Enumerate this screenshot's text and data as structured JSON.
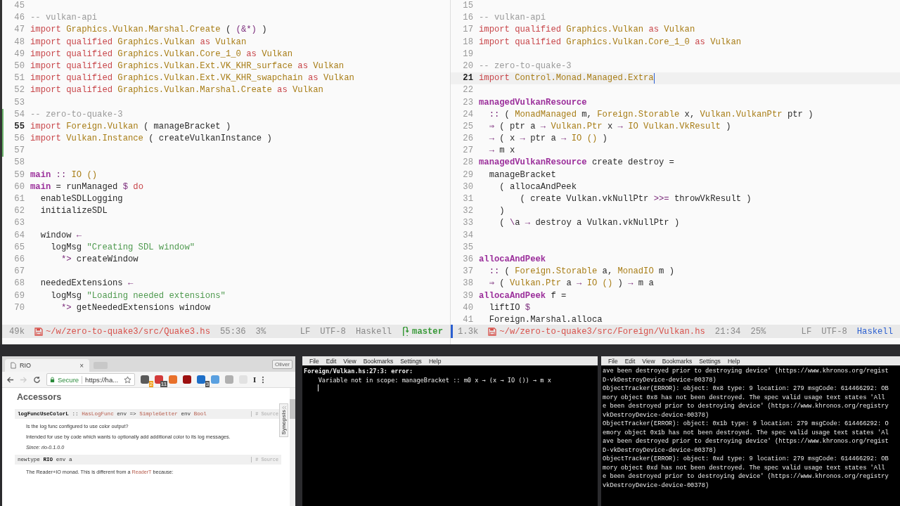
{
  "editors": [
    {
      "active": false,
      "lines": [
        {
          "n": "45",
          "current": false,
          "changed": false
        },
        {
          "n": "46",
          "current": false,
          "changed": false,
          "tokens": [
            {
              "kind": "comment",
              "text": "-- vulkan-api"
            }
          ]
        },
        {
          "n": "47",
          "current": false,
          "changed": false,
          "tokens": [
            {
              "kind": "kw",
              "text": "import"
            },
            {
              "kind": "mod",
              "text": " Graphics.Vulkan.Marshal.Create"
            },
            {
              "kind": "plain",
              "text": " ( "
            },
            {
              "kind": "op",
              "text": "(&*)"
            },
            {
              "kind": "plain",
              "text": " )"
            }
          ]
        },
        {
          "n": "48",
          "current": false,
          "changed": false,
          "tokens": [
            {
              "kind": "kw",
              "text": "import qualified"
            },
            {
              "kind": "mod",
              "text": " Graphics.Vulkan"
            },
            {
              "kind": "kw",
              "text": " as"
            },
            {
              "kind": "mod",
              "text": " Vulkan"
            }
          ]
        },
        {
          "n": "49",
          "current": false,
          "changed": false,
          "tokens": [
            {
              "kind": "kw",
              "text": "import qualified"
            },
            {
              "kind": "mod",
              "text": " Graphics.Vulkan.Core_1_0"
            },
            {
              "kind": "kw",
              "text": " as"
            },
            {
              "kind": "mod",
              "text": " Vulkan"
            }
          ]
        },
        {
          "n": "50",
          "current": false,
          "changed": false,
          "tokens": [
            {
              "kind": "kw",
              "text": "import qualified"
            },
            {
              "kind": "mod",
              "text": " Graphics.Vulkan.Ext.VK_KHR_surface"
            },
            {
              "kind": "kw",
              "text": " as"
            },
            {
              "kind": "mod",
              "text": " Vulkan"
            }
          ]
        },
        {
          "n": "51",
          "current": false,
          "changed": false,
          "tokens": [
            {
              "kind": "kw",
              "text": "import qualified"
            },
            {
              "kind": "mod",
              "text": " Graphics.Vulkan.Ext.VK_KHR_swapchain"
            },
            {
              "kind": "kw",
              "text": " as"
            },
            {
              "kind": "mod",
              "text": " Vulkan"
            }
          ]
        },
        {
          "n": "52",
          "current": false,
          "changed": false,
          "tokens": [
            {
              "kind": "kw",
              "text": "import qualified"
            },
            {
              "kind": "mod",
              "text": " Graphics.Vulkan.Marshal.Create"
            },
            {
              "kind": "kw",
              "text": " as"
            },
            {
              "kind": "mod",
              "text": " Vulkan"
            }
          ]
        },
        {
          "n": "53",
          "current": false,
          "changed": false
        },
        {
          "n": "54",
          "current": false,
          "changed": true,
          "tokens": [
            {
              "kind": "comment",
              "text": "-- zero-to-quake-3"
            }
          ]
        },
        {
          "n": "55",
          "current": true,
          "changed": true,
          "tokens": [
            {
              "kind": "kw",
              "text": "import"
            },
            {
              "kind": "mod",
              "text": " Foreign.Vulkan"
            },
            {
              "kind": "plain",
              "text": " ( manageBracket )"
            }
          ]
        },
        {
          "n": "56",
          "current": false,
          "changed": true,
          "tokens": [
            {
              "kind": "kw",
              "text": "import"
            },
            {
              "kind": "mod",
              "text": " Vulkan.Instance"
            },
            {
              "kind": "plain",
              "text": " ( createVulkanInstance )"
            }
          ]
        },
        {
          "n": "57",
          "current": false,
          "changed": true
        },
        {
          "n": "58",
          "current": false,
          "changed": false
        },
        {
          "n": "59",
          "current": false,
          "changed": false,
          "tokens": [
            {
              "kind": "def",
              "text": "main"
            },
            {
              "kind": "op",
              "text": " ::"
            },
            {
              "kind": "mod",
              "text": " IO ()"
            }
          ]
        },
        {
          "n": "60",
          "current": false,
          "changed": false,
          "tokens": [
            {
              "kind": "def",
              "text": "main"
            },
            {
              "kind": "plain",
              "text": " = runManaged "
            },
            {
              "kind": "op",
              "text": "$"
            },
            {
              "kind": "kw",
              "text": " do"
            }
          ]
        },
        {
          "n": "61",
          "current": false,
          "changed": false,
          "tokens": [
            {
              "kind": "plain",
              "text": "  enableSDLLogging"
            }
          ]
        },
        {
          "n": "62",
          "current": false,
          "changed": false,
          "tokens": [
            {
              "kind": "plain",
              "text": "  initializeSDL"
            }
          ]
        },
        {
          "n": "63",
          "current": false,
          "changed": false
        },
        {
          "n": "64",
          "current": false,
          "changed": false,
          "tokens": [
            {
              "kind": "plain",
              "text": "  window "
            },
            {
              "kind": "op",
              "text": "←"
            }
          ]
        },
        {
          "n": "65",
          "current": false,
          "changed": false,
          "tokens": [
            {
              "kind": "plain",
              "text": "    logMsg "
            },
            {
              "kind": "str",
              "text": "\"Creating SDL window\""
            }
          ]
        },
        {
          "n": "66",
          "current": false,
          "changed": false,
          "tokens": [
            {
              "kind": "op",
              "text": "      *>"
            },
            {
              "kind": "plain",
              "text": " createWindow"
            }
          ]
        },
        {
          "n": "67",
          "current": false,
          "changed": false
        },
        {
          "n": "68",
          "current": false,
          "changed": false,
          "tokens": [
            {
              "kind": "plain",
              "text": "  neededExtensions "
            },
            {
              "kind": "op",
              "text": "←"
            }
          ]
        },
        {
          "n": "69",
          "current": false,
          "changed": false,
          "tokens": [
            {
              "kind": "plain",
              "text": "    logMsg "
            },
            {
              "kind": "str",
              "text": "\"Loading needed extensions\""
            }
          ]
        },
        {
          "n": "70",
          "current": false,
          "changed": false,
          "tokens": [
            {
              "kind": "op",
              "text": "      *>"
            },
            {
              "kind": "plain",
              "text": " getNeededExtensions window"
            }
          ]
        }
      ],
      "status": {
        "size": "49k",
        "modified": true,
        "file": "~/w/zero-to-quake3/src/Quake3.hs",
        "position": "55:36",
        "percent": "3%",
        "eol": "LF",
        "encoding": "UTF-8",
        "mode": "Haskell",
        "branch": "master"
      }
    },
    {
      "active": true,
      "lines": [
        {
          "n": "15",
          "current": false,
          "changed": false
        },
        {
          "n": "16",
          "current": false,
          "changed": false,
          "tokens": [
            {
              "kind": "comment",
              "text": "-- vulkan-api"
            }
          ]
        },
        {
          "n": "17",
          "current": false,
          "changed": false,
          "tokens": [
            {
              "kind": "kw",
              "text": "import qualified"
            },
            {
              "kind": "mod",
              "text": " Graphics.Vulkan"
            },
            {
              "kind": "kw",
              "text": " as"
            },
            {
              "kind": "mod",
              "text": " Vulkan"
            }
          ]
        },
        {
          "n": "18",
          "current": false,
          "changed": false,
          "tokens": [
            {
              "kind": "kw",
              "text": "import qualified"
            },
            {
              "kind": "mod",
              "text": " Graphics.Vulkan.Core_1_0"
            },
            {
              "kind": "kw",
              "text": " as"
            },
            {
              "kind": "mod",
              "text": " Vulkan"
            }
          ]
        },
        {
          "n": "19",
          "current": false,
          "changed": false
        },
        {
          "n": "20",
          "current": false,
          "changed": false,
          "tokens": [
            {
              "kind": "comment",
              "text": "-- zero-to-quake-3"
            }
          ]
        },
        {
          "n": "21",
          "current": true,
          "changed": false,
          "tokens": [
            {
              "kind": "kw",
              "text": "import"
            },
            {
              "kind": "mod",
              "text": " Control.Monad.Managed.Extra"
            }
          ]
        },
        {
          "n": "22",
          "current": false,
          "changed": false
        },
        {
          "n": "23",
          "current": false,
          "changed": false,
          "tokens": [
            {
              "kind": "def",
              "text": "managedVulkanResource"
            }
          ]
        },
        {
          "n": "24",
          "current": false,
          "changed": false,
          "tokens": [
            {
              "kind": "op",
              "text": "  ::"
            },
            {
              "kind": "plain",
              "text": " ( "
            },
            {
              "kind": "mod",
              "text": "MonadManaged"
            },
            {
              "kind": "plain",
              "text": " m, "
            },
            {
              "kind": "mod",
              "text": "Foreign.Storable"
            },
            {
              "kind": "plain",
              "text": " x, "
            },
            {
              "kind": "mod",
              "text": "Vulkan.VulkanPtr"
            },
            {
              "kind": "plain",
              "text": " ptr )"
            }
          ]
        },
        {
          "n": "25",
          "current": false,
          "changed": false,
          "tokens": [
            {
              "kind": "op",
              "text": "  ⇒"
            },
            {
              "kind": "plain",
              "text": " ( ptr a "
            },
            {
              "kind": "op",
              "text": "→"
            },
            {
              "kind": "mod",
              "text": " Vulkan.Ptr"
            },
            {
              "kind": "plain",
              "text": " x "
            },
            {
              "kind": "op",
              "text": "→"
            },
            {
              "kind": "mod",
              "text": " IO Vulkan.VkResult"
            },
            {
              "kind": "plain",
              "text": " )"
            }
          ]
        },
        {
          "n": "26",
          "current": false,
          "changed": false,
          "tokens": [
            {
              "kind": "op",
              "text": "  →"
            },
            {
              "kind": "plain",
              "text": " ( x "
            },
            {
              "kind": "op",
              "text": "→"
            },
            {
              "kind": "plain",
              "text": " ptr a "
            },
            {
              "kind": "op",
              "text": "→"
            },
            {
              "kind": "mod",
              "text": " IO ()"
            },
            {
              "kind": "plain",
              "text": " )"
            }
          ]
        },
        {
          "n": "27",
          "current": false,
          "changed": false,
          "tokens": [
            {
              "kind": "op",
              "text": "  →"
            },
            {
              "kind": "plain",
              "text": " m x"
            }
          ]
        },
        {
          "n": "28",
          "current": false,
          "changed": false,
          "tokens": [
            {
              "kind": "def",
              "text": "managedVulkanResource"
            },
            {
              "kind": "plain",
              "text": " create destroy ="
            }
          ]
        },
        {
          "n": "29",
          "current": false,
          "changed": false,
          "tokens": [
            {
              "kind": "plain",
              "text": "  manageBracket"
            }
          ]
        },
        {
          "n": "30",
          "current": false,
          "changed": false,
          "tokens": [
            {
              "kind": "plain",
              "text": "    ( allocaAndPeek"
            }
          ]
        },
        {
          "n": "31",
          "current": false,
          "changed": false,
          "tokens": [
            {
              "kind": "plain",
              "text": "        ( create Vulkan.vkNullPtr "
            },
            {
              "kind": "op",
              "text": ">>="
            },
            {
              "kind": "plain",
              "text": " throwVkResult )"
            }
          ]
        },
        {
          "n": "32",
          "current": false,
          "changed": false,
          "tokens": [
            {
              "kind": "plain",
              "text": "    )"
            }
          ]
        },
        {
          "n": "33",
          "current": false,
          "changed": false,
          "tokens": [
            {
              "kind": "plain",
              "text": "    ( "
            },
            {
              "kind": "op",
              "text": "\\"
            },
            {
              "kind": "plain",
              "text": "a "
            },
            {
              "kind": "op",
              "text": "→"
            },
            {
              "kind": "plain",
              "text": " destroy a Vulkan.vkNullPtr )"
            }
          ]
        },
        {
          "n": "34",
          "current": false,
          "changed": false
        },
        {
          "n": "35",
          "current": false,
          "changed": false
        },
        {
          "n": "36",
          "current": false,
          "changed": false,
          "tokens": [
            {
              "kind": "def",
              "text": "allocaAndPeek"
            }
          ]
        },
        {
          "n": "37",
          "current": false,
          "changed": false,
          "tokens": [
            {
              "kind": "op",
              "text": "  ::"
            },
            {
              "kind": "plain",
              "text": " ( "
            },
            {
              "kind": "mod",
              "text": "Foreign.Storable"
            },
            {
              "kind": "plain",
              "text": " a, "
            },
            {
              "kind": "mod",
              "text": "MonadIO"
            },
            {
              "kind": "plain",
              "text": " m )"
            }
          ]
        },
        {
          "n": "38",
          "current": false,
          "changed": false,
          "tokens": [
            {
              "kind": "op",
              "text": "  ⇒"
            },
            {
              "kind": "plain",
              "text": " ( "
            },
            {
              "kind": "mod",
              "text": "Vulkan.Ptr"
            },
            {
              "kind": "plain",
              "text": " a "
            },
            {
              "kind": "op",
              "text": "→"
            },
            {
              "kind": "mod",
              "text": " IO ()"
            },
            {
              "kind": "plain",
              "text": " ) "
            },
            {
              "kind": "op",
              "text": "→"
            },
            {
              "kind": "plain",
              "text": " m a"
            }
          ]
        },
        {
          "n": "39",
          "current": false,
          "changed": false,
          "tokens": [
            {
              "kind": "def",
              "text": "allocaAndPeek"
            },
            {
              "kind": "plain",
              "text": " f ="
            }
          ]
        },
        {
          "n": "40",
          "current": false,
          "changed": false,
          "tokens": [
            {
              "kind": "plain",
              "text": "  liftIO "
            },
            {
              "kind": "op",
              "text": "$"
            }
          ]
        },
        {
          "n": "41",
          "current": false,
          "changed": false,
          "tokens": [
            {
              "kind": "plain",
              "text": "  Foreign.Marshal.alloca"
            }
          ]
        }
      ],
      "status": {
        "size": "1.3k",
        "modified": true,
        "file": "~/w/zero-to-quake3/src/Foreign/Vulkan.hs",
        "position": "21:34",
        "percent": "25%",
        "eol": "LF",
        "encoding": "UTF-8",
        "mode": "Haskell"
      }
    }
  ],
  "browser": {
    "tab": {
      "title": "RIO",
      "close": "×"
    },
    "profile": "Oliver",
    "secure": "Secure",
    "url": "https://ha...",
    "extensions": [
      {
        "color": "#5a5a5a",
        "badge": "2"
      },
      {
        "color": "#d23a3a",
        "badge": "11"
      },
      {
        "color": "#e8702a"
      },
      {
        "color": "#9c1010"
      },
      {
        "color": "#1e6fc8",
        "badge": "3"
      },
      {
        "color": "#5aa0e0"
      },
      {
        "color": "#b0b0b0"
      },
      {
        "color": "#e2e2e2"
      }
    ],
    "extension_letter": "I",
    "heading": "Accessors",
    "synopsis": "Synopsis",
    "entries": [
      {
        "signature": [
          {
            "kind": "name",
            "text": "logFuncUseColorL"
          },
          {
            "kind": "plain",
            "text": " :: "
          },
          {
            "kind": "link",
            "text": "HasLogFunc"
          },
          {
            "kind": "plain",
            "text": " env => "
          },
          {
            "kind": "link",
            "text": "SimpleGetter"
          },
          {
            "kind": "plain",
            "text": " env "
          },
          {
            "kind": "link",
            "text": "Bool"
          }
        ],
        "source": "# Source",
        "paragraphs": [
          {
            "kind": "text",
            "parts": [
              {
                "kind": "text",
                "text": "Is the log func configured to use color output?"
              }
            ]
          },
          {
            "kind": "text",
            "parts": [
              {
                "kind": "text",
                "text": "Intended for use by code which wants to optionally add additional color to its log messages."
              }
            ]
          },
          {
            "kind": "since",
            "parts": [
              {
                "kind": "text",
                "text": "Since: rio-0.1.0.0"
              }
            ]
          }
        ]
      },
      {
        "signature": [
          {
            "kind": "plain",
            "text": "newtype "
          },
          {
            "kind": "name",
            "text": "RIO"
          },
          {
            "kind": "plain",
            "text": " env a"
          }
        ],
        "source": "# Source",
        "paragraphs": [
          {
            "kind": "text",
            "parts": [
              {
                "kind": "text",
                "text": "The Reader+IO monad. This is different from a "
              },
              {
                "kind": "link",
                "text": "ReaderT"
              },
              {
                "kind": "text",
                "text": " because:"
              }
            ]
          }
        ]
      }
    ]
  },
  "terminals": [
    {
      "menu": [
        "File",
        "Edit",
        "View",
        "Bookmarks",
        "Settings",
        "Help"
      ],
      "cursor": true,
      "lines": [
        {
          "bold": true,
          "text": "Foreign/Vulkan.hs:27:3: error:"
        },
        {
          "bold": false,
          "text": "    Variable not in scope: manageBracket :: m0 x → (x → IO ()) → m x"
        }
      ]
    },
    {
      "menu": [
        "File",
        "Edit",
        "View",
        "Bookmarks",
        "Settings",
        "Help"
      ],
      "lines": [
        {
          "bold": false,
          "text": "ave been destroyed prior to destroying device' (https://www.khronos.org/regist"
        },
        {
          "bold": false,
          "text": "D-vkDestroyDevice-device-00378)"
        },
        {
          "bold": false,
          "text": "ObjectTracker(ERROR): object: 0x8 type: 9 location: 279 msgCode: 614466292: OB"
        },
        {
          "bold": false,
          "text": "mory object 0x8 has not been destroyed. The spec valid usage text states 'All"
        },
        {
          "bold": false,
          "text": "e been destroyed prior to destroying device' (https://www.khronos.org/registry"
        },
        {
          "bold": false,
          "text": "vkDestroyDevice-device-00378)"
        },
        {
          "bold": false,
          "text": "ObjectTracker(ERROR): object: 0x1b type: 9 location: 279 msgCode: 614466292: O"
        },
        {
          "bold": false,
          "text": "emory object 0x1b has not been destroyed. The spec valid usage text states 'Al"
        },
        {
          "bold": false,
          "text": "ave been destroyed prior to destroying device' (https://www.khronos.org/regist"
        },
        {
          "bold": false,
          "text": "D-vkDestroyDevice-device-00378)"
        },
        {
          "bold": false,
          "text": "ObjectTracker(ERROR): object: 0xd type: 9 location: 279 msgCode: 614466292: OB"
        },
        {
          "bold": false,
          "text": "mory object 0xd has not been destroyed. The spec valid usage text states 'All"
        },
        {
          "bold": false,
          "text": "e been destroyed prior to destroying device' (https://www.khronos.org/registry"
        },
        {
          "bold": false,
          "text": "vkDestroyDevice-device-00378)"
        }
      ]
    }
  ]
}
